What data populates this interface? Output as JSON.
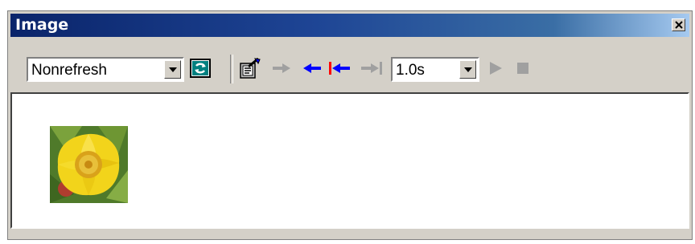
{
  "window": {
    "title": "Image"
  },
  "toolbar": {
    "mode_select": {
      "value": "Nonrefresh"
    },
    "interval_select": {
      "value": "1.0s"
    },
    "icons": {
      "refresh": "refresh-icon",
      "properties": "properties-icon",
      "forward": "arrow-right-icon",
      "back": "arrow-left-icon",
      "first": "first-frame-icon",
      "last": "last-frame-icon",
      "play": "play-icon",
      "stop": "stop-icon"
    }
  },
  "colors": {
    "title_bar_start": "#0a246a",
    "title_bar_end": "#a6caf0",
    "chrome": "#d4d0c8",
    "arrow_blue": "#0000ff",
    "arrow_red": "#ff0000",
    "disabled": "#a0a0a0"
  },
  "content": {
    "thumbnail": "yellow-flower-image"
  }
}
